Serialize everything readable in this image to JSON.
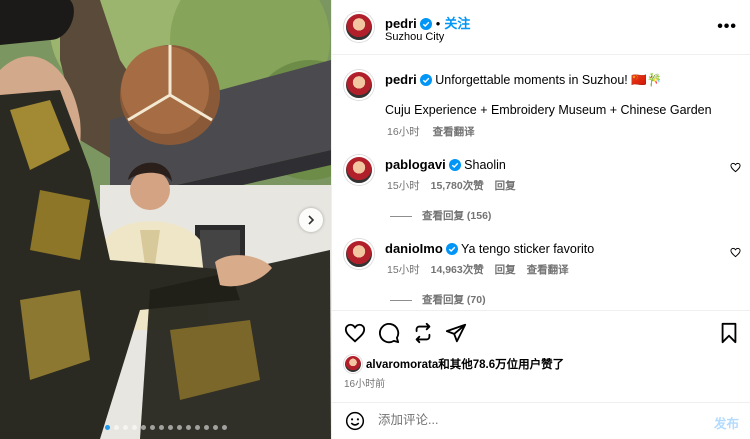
{
  "post": {
    "author": "pedri",
    "follow_label": "关注",
    "location": "Suzhou City",
    "more_label": "•••",
    "caption_text": "Unforgettable moments in Suzhou! 🇨🇳🎋",
    "caption_line2": "Cuju Experience + Embroidery Museum + Chinese Garden",
    "caption_time": "16小时",
    "caption_translate": "查看翻译",
    "image_dots": 14,
    "active_dot": 0
  },
  "comments": [
    {
      "user": "pablogavi",
      "text": "Shaolin",
      "time": "15小时",
      "likes": "15,780次赞",
      "reply": "回复",
      "view_replies": "查看回复 (156)"
    },
    {
      "user": "danioImo",
      "text": "Ya tengo sticker favorito",
      "time": "15小时",
      "likes": "14,963次赞",
      "reply": "回复",
      "translate": "查看翻译",
      "view_replies": "查看回复 (70)"
    }
  ],
  "likes_line": {
    "user": "alvaromorata",
    "rest": "和其他78.6万位用户赞了"
  },
  "post_time": "16小时前",
  "composer": {
    "placeholder": "添加评论...",
    "post_label": "发布"
  },
  "colors": {
    "accent": "#0095f6",
    "muted": "#737373",
    "post_disabled": "#b3dbff"
  }
}
